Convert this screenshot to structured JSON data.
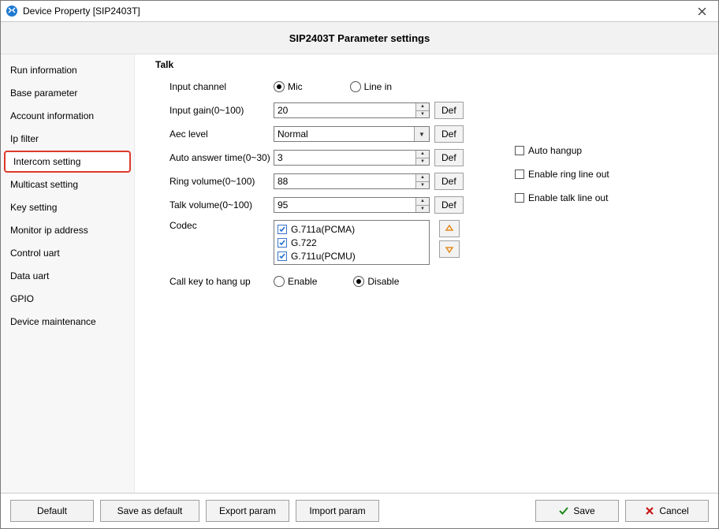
{
  "window": {
    "title": "Device Property [SIP2403T]"
  },
  "header": {
    "title": "SIP2403T Parameter settings"
  },
  "sidebar": {
    "items": [
      {
        "label": "Run information"
      },
      {
        "label": "Base parameter"
      },
      {
        "label": "Account information"
      },
      {
        "label": "Ip filter"
      },
      {
        "label": "Intercom setting",
        "active": true
      },
      {
        "label": "Multicast setting"
      },
      {
        "label": "Key setting"
      },
      {
        "label": "Monitor ip address"
      },
      {
        "label": "Control uart"
      },
      {
        "label": "Data uart"
      },
      {
        "label": "GPIO"
      },
      {
        "label": "Device maintenance"
      }
    ]
  },
  "talk": {
    "section_title": "Talk",
    "labels": {
      "input_channel": "Input channel",
      "input_gain": "Input gain(0~100)",
      "aec_level": "Aec level",
      "auto_answer_time": "Auto answer time(0~30)",
      "ring_volume": "Ring volume(0~100)",
      "talk_volume": "Talk volume(0~100)",
      "codec": "Codec",
      "call_key_hangup": "Call key to hang up"
    },
    "input_channel": {
      "options": [
        "Mic",
        "Line in"
      ],
      "selected": "Mic"
    },
    "input_gain": {
      "value": "20"
    },
    "aec_level": {
      "value": "Normal"
    },
    "auto_answer_time": {
      "value": "3"
    },
    "ring_volume": {
      "value": "88"
    },
    "talk_volume": {
      "value": "95"
    },
    "codec": {
      "items": [
        {
          "label": "G.711a(PCMA)",
          "checked": true
        },
        {
          "label": "G.722",
          "checked": true
        },
        {
          "label": "G.711u(PCMU)",
          "checked": true
        }
      ]
    },
    "call_key_hangup": {
      "options": [
        "Enable",
        "Disable"
      ],
      "selected": "Disable"
    },
    "right_options": {
      "auto_hangup": {
        "label": "Auto hangup",
        "checked": false
      },
      "enable_ring_line_out": {
        "label": "Enable ring line out",
        "checked": false
      },
      "enable_talk_line_out": {
        "label": "Enable talk line out",
        "checked": false
      }
    },
    "def_label": "Def"
  },
  "footer": {
    "default": "Default",
    "save_as_default": "Save as default",
    "export_param": "Export param",
    "import_param": "Import param",
    "save": "Save",
    "cancel": "Cancel"
  }
}
